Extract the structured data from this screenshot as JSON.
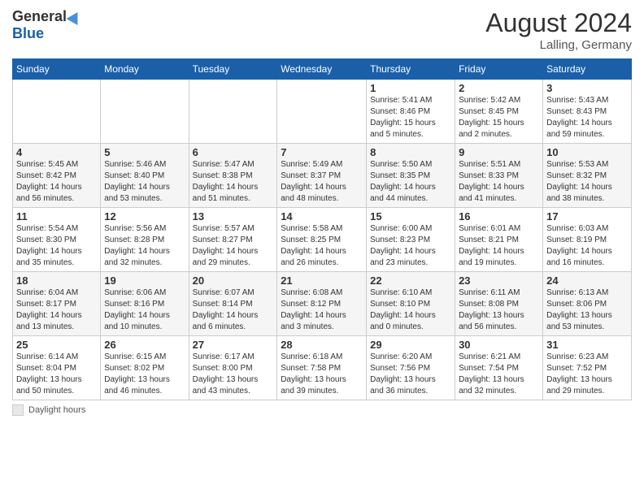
{
  "header": {
    "logo_general": "General",
    "logo_blue": "Blue",
    "month_year": "August 2024",
    "location": "Lalling, Germany"
  },
  "footer": {
    "daylight_label": "Daylight hours"
  },
  "days_of_week": [
    "Sunday",
    "Monday",
    "Tuesday",
    "Wednesday",
    "Thursday",
    "Friday",
    "Saturday"
  ],
  "weeks": [
    [
      {
        "day": "",
        "info": ""
      },
      {
        "day": "",
        "info": ""
      },
      {
        "day": "",
        "info": ""
      },
      {
        "day": "",
        "info": ""
      },
      {
        "day": "1",
        "info": "Sunrise: 5:41 AM\nSunset: 8:46 PM\nDaylight: 15 hours\nand 5 minutes."
      },
      {
        "day": "2",
        "info": "Sunrise: 5:42 AM\nSunset: 8:45 PM\nDaylight: 15 hours\nand 2 minutes."
      },
      {
        "day": "3",
        "info": "Sunrise: 5:43 AM\nSunset: 8:43 PM\nDaylight: 14 hours\nand 59 minutes."
      }
    ],
    [
      {
        "day": "4",
        "info": "Sunrise: 5:45 AM\nSunset: 8:42 PM\nDaylight: 14 hours\nand 56 minutes."
      },
      {
        "day": "5",
        "info": "Sunrise: 5:46 AM\nSunset: 8:40 PM\nDaylight: 14 hours\nand 53 minutes."
      },
      {
        "day": "6",
        "info": "Sunrise: 5:47 AM\nSunset: 8:38 PM\nDaylight: 14 hours\nand 51 minutes."
      },
      {
        "day": "7",
        "info": "Sunrise: 5:49 AM\nSunset: 8:37 PM\nDaylight: 14 hours\nand 48 minutes."
      },
      {
        "day": "8",
        "info": "Sunrise: 5:50 AM\nSunset: 8:35 PM\nDaylight: 14 hours\nand 44 minutes."
      },
      {
        "day": "9",
        "info": "Sunrise: 5:51 AM\nSunset: 8:33 PM\nDaylight: 14 hours\nand 41 minutes."
      },
      {
        "day": "10",
        "info": "Sunrise: 5:53 AM\nSunset: 8:32 PM\nDaylight: 14 hours\nand 38 minutes."
      }
    ],
    [
      {
        "day": "11",
        "info": "Sunrise: 5:54 AM\nSunset: 8:30 PM\nDaylight: 14 hours\nand 35 minutes."
      },
      {
        "day": "12",
        "info": "Sunrise: 5:56 AM\nSunset: 8:28 PM\nDaylight: 14 hours\nand 32 minutes."
      },
      {
        "day": "13",
        "info": "Sunrise: 5:57 AM\nSunset: 8:27 PM\nDaylight: 14 hours\nand 29 minutes."
      },
      {
        "day": "14",
        "info": "Sunrise: 5:58 AM\nSunset: 8:25 PM\nDaylight: 14 hours\nand 26 minutes."
      },
      {
        "day": "15",
        "info": "Sunrise: 6:00 AM\nSunset: 8:23 PM\nDaylight: 14 hours\nand 23 minutes."
      },
      {
        "day": "16",
        "info": "Sunrise: 6:01 AM\nSunset: 8:21 PM\nDaylight: 14 hours\nand 19 minutes."
      },
      {
        "day": "17",
        "info": "Sunrise: 6:03 AM\nSunset: 8:19 PM\nDaylight: 14 hours\nand 16 minutes."
      }
    ],
    [
      {
        "day": "18",
        "info": "Sunrise: 6:04 AM\nSunset: 8:17 PM\nDaylight: 14 hours\nand 13 minutes."
      },
      {
        "day": "19",
        "info": "Sunrise: 6:06 AM\nSunset: 8:16 PM\nDaylight: 14 hours\nand 10 minutes."
      },
      {
        "day": "20",
        "info": "Sunrise: 6:07 AM\nSunset: 8:14 PM\nDaylight: 14 hours\nand 6 minutes."
      },
      {
        "day": "21",
        "info": "Sunrise: 6:08 AM\nSunset: 8:12 PM\nDaylight: 14 hours\nand 3 minutes."
      },
      {
        "day": "22",
        "info": "Sunrise: 6:10 AM\nSunset: 8:10 PM\nDaylight: 14 hours\nand 0 minutes."
      },
      {
        "day": "23",
        "info": "Sunrise: 6:11 AM\nSunset: 8:08 PM\nDaylight: 13 hours\nand 56 minutes."
      },
      {
        "day": "24",
        "info": "Sunrise: 6:13 AM\nSunset: 8:06 PM\nDaylight: 13 hours\nand 53 minutes."
      }
    ],
    [
      {
        "day": "25",
        "info": "Sunrise: 6:14 AM\nSunset: 8:04 PM\nDaylight: 13 hours\nand 50 minutes."
      },
      {
        "day": "26",
        "info": "Sunrise: 6:15 AM\nSunset: 8:02 PM\nDaylight: 13 hours\nand 46 minutes."
      },
      {
        "day": "27",
        "info": "Sunrise: 6:17 AM\nSunset: 8:00 PM\nDaylight: 13 hours\nand 43 minutes."
      },
      {
        "day": "28",
        "info": "Sunrise: 6:18 AM\nSunset: 7:58 PM\nDaylight: 13 hours\nand 39 minutes."
      },
      {
        "day": "29",
        "info": "Sunrise: 6:20 AM\nSunset: 7:56 PM\nDaylight: 13 hours\nand 36 minutes."
      },
      {
        "day": "30",
        "info": "Sunrise: 6:21 AM\nSunset: 7:54 PM\nDaylight: 13 hours\nand 32 minutes."
      },
      {
        "day": "31",
        "info": "Sunrise: 6:23 AM\nSunset: 7:52 PM\nDaylight: 13 hours\nand 29 minutes."
      }
    ]
  ]
}
